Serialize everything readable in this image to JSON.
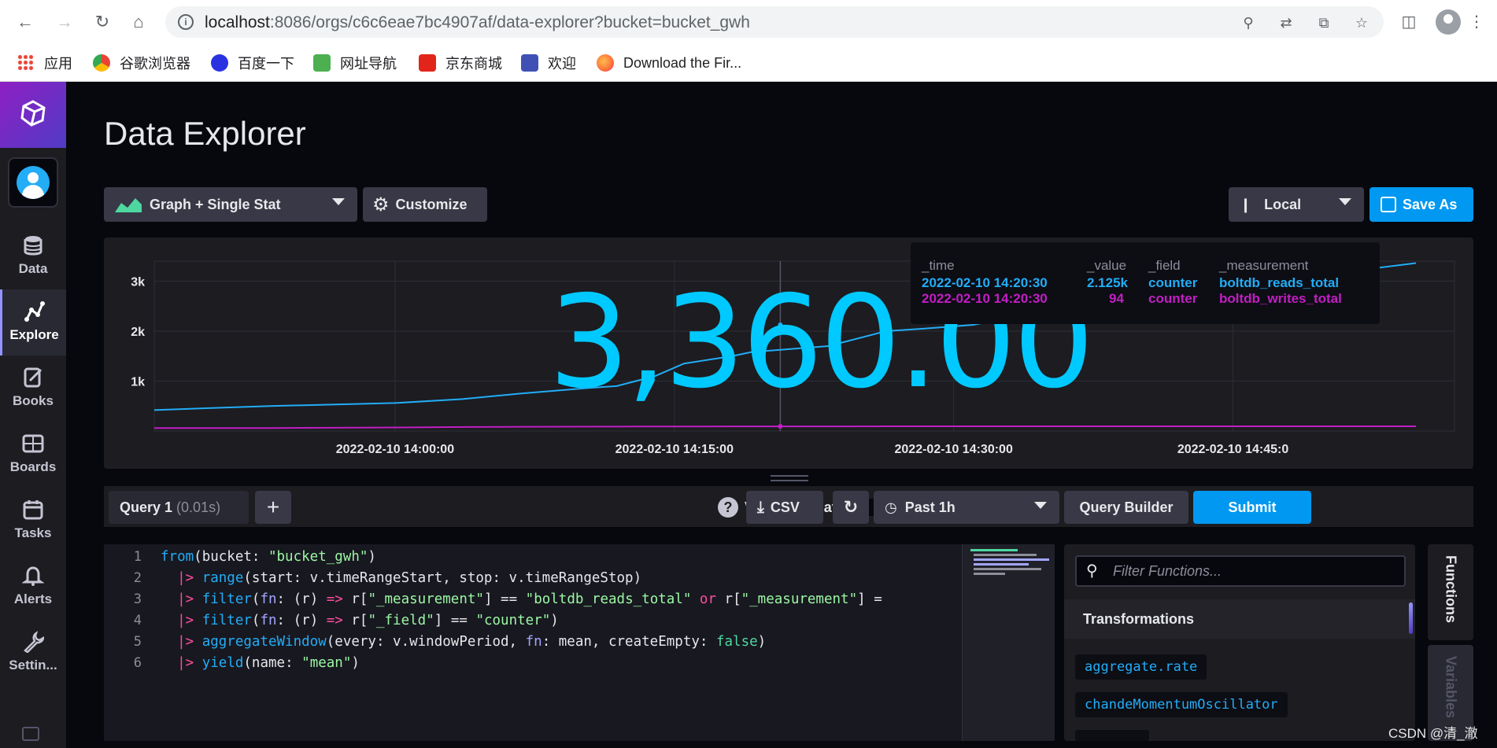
{
  "browser": {
    "url_host": "localhost",
    "url_path": ":8086/orgs/c6c6eae7bc4907af/data-explorer?bucket=bucket_gwh",
    "bookmarks": [
      {
        "label": "应用",
        "color": "#ea4335"
      },
      {
        "label": "谷歌浏览器",
        "color": "#34a853"
      },
      {
        "label": "百度一下",
        "color": "#2932e1"
      },
      {
        "label": "网址导航",
        "color": "#4caf50"
      },
      {
        "label": "京东商城",
        "color": "#e1251b"
      },
      {
        "label": "欢迎",
        "color": "#3f51b5"
      },
      {
        "label": "Download the Fir...",
        "color": "#ff7139"
      }
    ]
  },
  "sidebar": {
    "items": [
      {
        "label": "Data",
        "icon": "database-icon"
      },
      {
        "label": "Explore",
        "icon": "graph-icon"
      },
      {
        "label": "Books",
        "icon": "notebook-icon"
      },
      {
        "label": "Boards",
        "icon": "dashboard-icon"
      },
      {
        "label": "Tasks",
        "icon": "calendar-icon"
      },
      {
        "label": "Alerts",
        "icon": "bell-icon"
      },
      {
        "label": "Settin...",
        "icon": "wrench-icon"
      }
    ]
  },
  "page": {
    "title": "Data Explorer"
  },
  "toolbar": {
    "view_type": "Graph + Single Stat",
    "customize": "Customize",
    "timezone": "Local",
    "save_as": "Save As"
  },
  "graph": {
    "single_stat": "3,360.00",
    "tooltip": {
      "headers": [
        "_time",
        "_value",
        "_field",
        "_measurement"
      ],
      "rows": [
        {
          "time": "2022-02-10 14:20:30",
          "value": "2.125k",
          "field": "counter",
          "measurement": "boltdb_reads_total",
          "color": "#22adf6"
        },
        {
          "time": "2022-02-10 14:20:30",
          "value": "94",
          "field": "counter",
          "measurement": "boltdb_writes_total",
          "color": "#c21ec4"
        }
      ]
    }
  },
  "chart_data": {
    "type": "line",
    "y_ticks": [
      "3k",
      "2k",
      "1k"
    ],
    "x_ticks": [
      "2022-02-10 14:00:00",
      "2022-02-10 14:15:00",
      "2022-02-10 14:30:00",
      "2022-02-10 14:45:0"
    ],
    "ylim": [
      0,
      3400
    ],
    "x_minutes": [
      0,
      12,
      25,
      32,
      38,
      45,
      48,
      50,
      52,
      55,
      60,
      62,
      70,
      72,
      76,
      80,
      85,
      90,
      100,
      103,
      108,
      112,
      120,
      131
    ],
    "series": [
      {
        "name": "boltdb_reads_total",
        "color": "#22adf6",
        "values": [
          420,
          500,
          560,
          640,
          750,
          860,
          900,
          1000,
          1100,
          1350,
          1500,
          1580,
          1700,
          1800,
          2000,
          2050,
          2125,
          2300,
          2500,
          2580,
          2750,
          2950,
          3100,
          3360
        ]
      },
      {
        "name": "boltdb_writes_total",
        "color": "#c21ec4",
        "values": [
          60,
          60,
          70,
          80,
          85,
          88,
          88,
          90,
          90,
          90,
          92,
          92,
          92,
          92,
          94,
          94,
          94,
          94,
          94,
          94,
          94,
          94,
          94,
          94
        ]
      }
    ]
  },
  "query": {
    "tab_label": "Query 1",
    "tab_timing": "(0.01s)",
    "view_raw": "View Raw Data",
    "csv": "CSV",
    "time_range": "Past 1h",
    "query_builder": "Query Builder",
    "submit": "Submit"
  },
  "editor": {
    "line_numbers": [
      "1",
      "2",
      "3",
      "4",
      "5",
      "6"
    ]
  },
  "functions": {
    "search_placeholder": "Filter Functions...",
    "section": "Transformations",
    "items": [
      "aggregate.rate",
      "chandeMomentumOscillator"
    ],
    "tab_functions": "Functions",
    "tab_variables": "Variables"
  },
  "watermark": "CSDN @清_澈"
}
